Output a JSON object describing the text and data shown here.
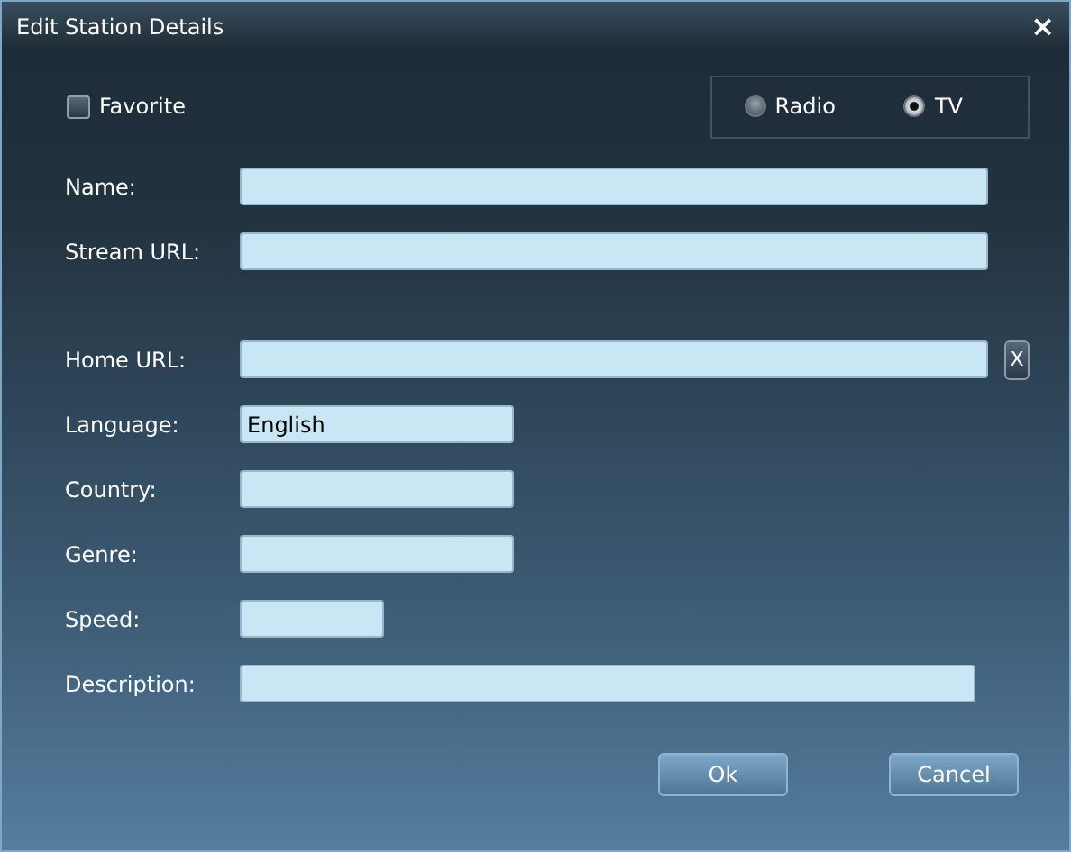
{
  "window": {
    "title": "Edit Station Details",
    "close": "×"
  },
  "favorite": {
    "label": "Favorite",
    "checked": false
  },
  "type_options": [
    {
      "label": "Radio",
      "selected": false
    },
    {
      "label": "TV",
      "selected": true
    }
  ],
  "fields": [
    {
      "label": "Name:"
    },
    {
      "label": "Stream URL:"
    },
    {
      "label": "Home URL:",
      "clear_button": "X"
    },
    {
      "label": "Language:",
      "value": "English"
    },
    {
      "label": "Country:"
    },
    {
      "label": "Genre:"
    },
    {
      "label": "Speed:"
    },
    {
      "label": "Description:"
    }
  ],
  "buttons": [
    "Ok",
    "Cancel"
  ]
}
